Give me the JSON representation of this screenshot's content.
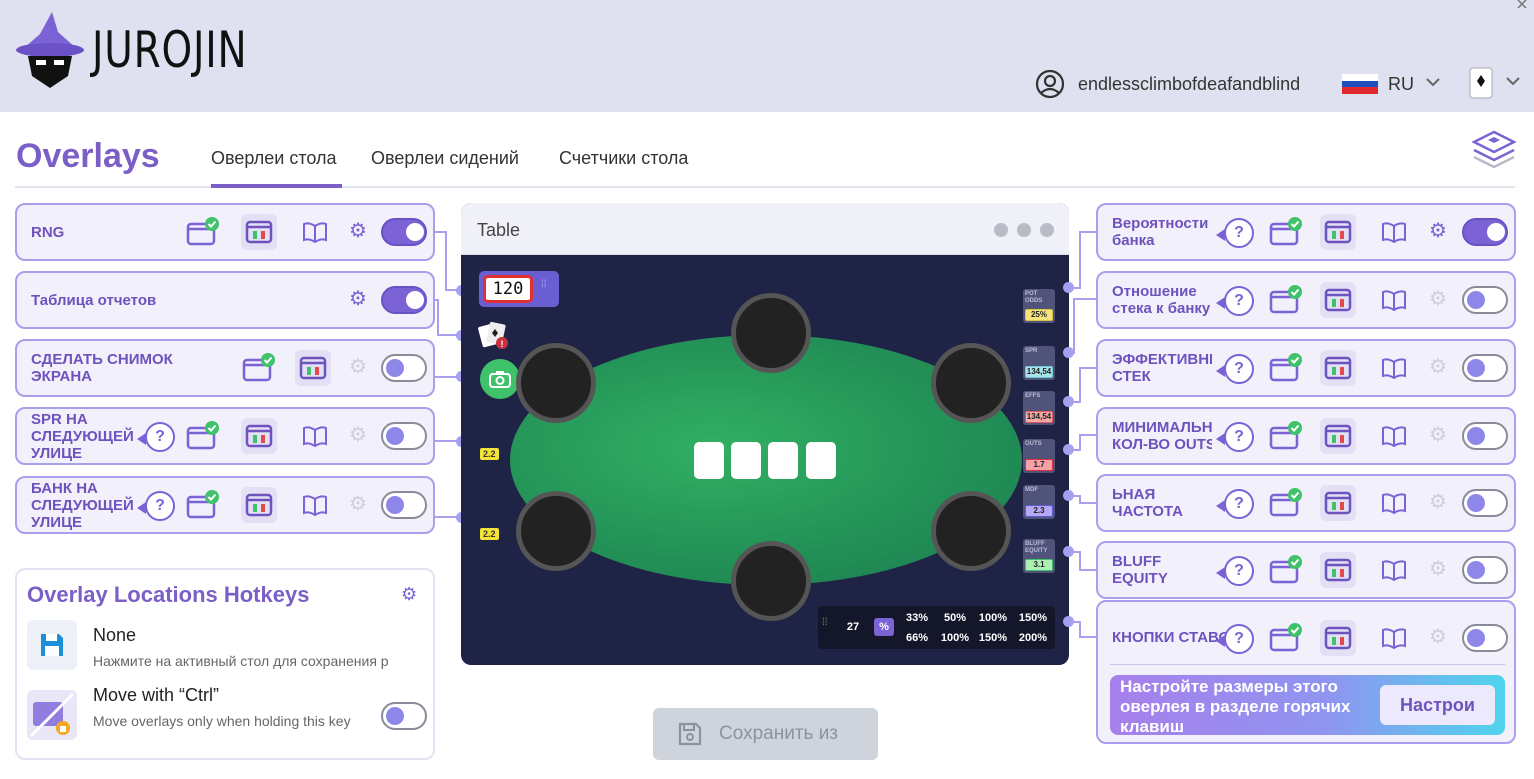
{
  "app": {
    "logo": "JUROJIN"
  },
  "header": {
    "username": "endlessclimbofdeafandblind",
    "language": "RU"
  },
  "page": {
    "title": "Overlays"
  },
  "tabs": [
    {
      "label": "Оверлеи стола",
      "active": true
    },
    {
      "label": "Оверлеи сидений",
      "active": false
    },
    {
      "label": "Счетчики стола",
      "active": false
    }
  ],
  "left_overlays": [
    {
      "label": "RNG",
      "enabled": true
    },
    {
      "label": "Таблица отчетов",
      "enabled": true
    },
    {
      "label": "СДЕЛАТЬ СНИМОК ЭКРАНА",
      "enabled": false
    },
    {
      "label": "SPR НА СЛЕДУЮЩЕЙ УЛИЦЕ",
      "enabled": false
    },
    {
      "label": "БАНК НА СЛЕДУЮЩЕЙ УЛИЦЕ",
      "enabled": false
    }
  ],
  "right_overlays": [
    {
      "label": "Вероятности банка",
      "enabled": true
    },
    {
      "label": "Отношение стека к банку",
      "enabled": false
    },
    {
      "label": "ЭФФЕКТИВНЫЙ СТЕК",
      "enabled": false
    },
    {
      "label": "МИНИМАЛЬНОЕ КОЛ-ВО OUTS",
      "enabled": false
    },
    {
      "label": "ЬНАЯ ЧАСТОТА",
      "enabled": false
    },
    {
      "label": "BLUFF EQUITY",
      "enabled": false
    },
    {
      "label": "КНОПКИ СТАВОК",
      "enabled": false
    }
  ],
  "table_preview": {
    "title": "Table",
    "rng_value": "120",
    "left_badges": [
      "2.2",
      "2.2"
    ],
    "stats": [
      {
        "label": "POT ODDS",
        "value": "25%",
        "color": "#f5e47a"
      },
      {
        "label": "SPR",
        "value": "134,54",
        "color": "#a9e3e9"
      },
      {
        "label": "EFFS",
        "value": "134,54",
        "color": "#f2a9a9"
      },
      {
        "label": "OUTS",
        "value": "1.7",
        "color": "#f7a0a8"
      },
      {
        "label": "MDF",
        "value": "2.3",
        "color": "#b7a8f5"
      },
      {
        "label": "BLUFF EQUITY",
        "value": "3.1",
        "color": "#aef0b4"
      }
    ],
    "bet_buttons": {
      "count": "27",
      "unit": "%",
      "row1": [
        "33%",
        "50%",
        "100%",
        "150%"
      ],
      "row2": [
        "66%",
        "100%",
        "150%",
        "200%"
      ]
    }
  },
  "hotkeys": {
    "title": "Overlay Locations Hotkeys",
    "save_title": "None",
    "save_desc": "Нажмите на активный стол для сохранения р",
    "move_title": "Move with “Ctrl”",
    "move_desc": "Move overlays only when holding this key"
  },
  "save_button": "Сохранить из",
  "banner": {
    "text": "Настройте размеры этого оверлея в разделе горячих клавиш",
    "button": "Настрои"
  },
  "colors": {
    "accent": "#7b5fc7",
    "header_bg": "#dfe1f0",
    "felt": "#239257"
  }
}
